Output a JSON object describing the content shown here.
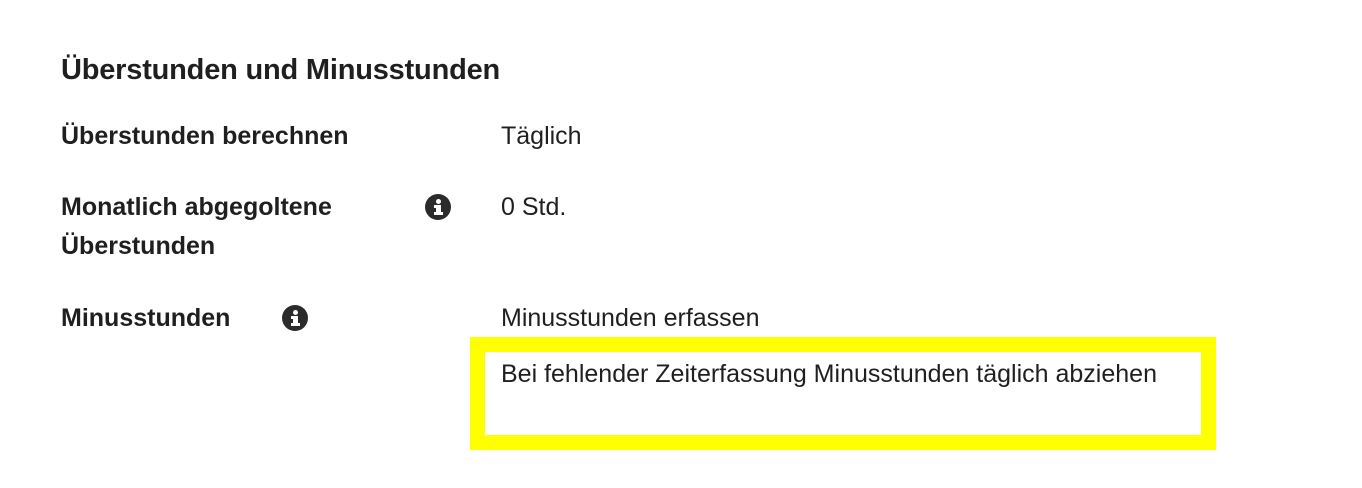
{
  "section": {
    "title": "Überstunden und Minusstunden"
  },
  "rows": [
    {
      "label": "Überstunden berechnen",
      "value": "Täglich"
    },
    {
      "label_line1": "Monatlich abgegoltene",
      "label_line2": "Überstunden",
      "info_icon": "info-icon",
      "value": "0 Std."
    },
    {
      "label": "Minusstunden",
      "info_icon": "info-icon",
      "value": "Minusstunden erfassen",
      "highlighted_detail": "Bei fehlender Zeiterfassung Minusstunden täglich abziehen"
    }
  ],
  "colors": {
    "highlight": "#ffff00",
    "text": "#1f1f1f",
    "icon": "#2b2b2b"
  }
}
